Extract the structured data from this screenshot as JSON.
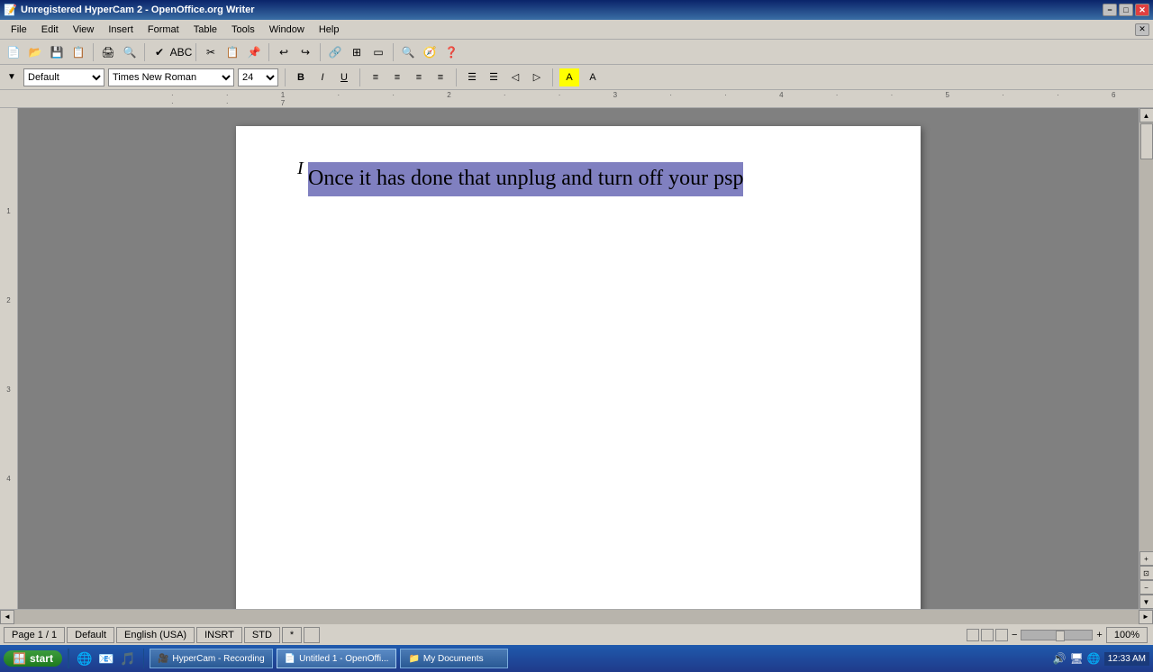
{
  "titlebar": {
    "title": "Unregistered HyperCam 2 - OpenOffice.org Writer",
    "min_label": "−",
    "max_label": "□",
    "close_label": "✕"
  },
  "menubar": {
    "items": [
      "File",
      "Edit",
      "View",
      "Insert",
      "Format",
      "Table",
      "Tools",
      "Window",
      "Help"
    ]
  },
  "toolbar": {
    "buttons": [
      "💾",
      "📂",
      "🖨",
      "✂",
      "📋",
      "↩",
      "↪",
      "🔍"
    ]
  },
  "formatting": {
    "style_label": "Default",
    "font_label": "Times New Roman",
    "size_label": "24",
    "bold_label": "B",
    "italic_label": "I",
    "underline_label": "U"
  },
  "document": {
    "selected_text": "Once it has done that unplug and turn off your psp"
  },
  "statusbar": {
    "page_info": "Page 1 / 1",
    "style": "Default",
    "language": "English (USA)",
    "insert_mode": "INSRT",
    "std": "STD",
    "star": "*",
    "zoom": "100%"
  },
  "taskbar": {
    "start_label": "start",
    "items": [
      {
        "label": "HyperCam - Recording",
        "icon": "🎥"
      },
      {
        "label": "Untitled 1 - OpenOffi...",
        "icon": "📄"
      },
      {
        "label": "My Documents",
        "icon": "📁"
      }
    ],
    "clock": "12:33 AM",
    "tray_icons": [
      "🔊",
      "🖥"
    ]
  }
}
